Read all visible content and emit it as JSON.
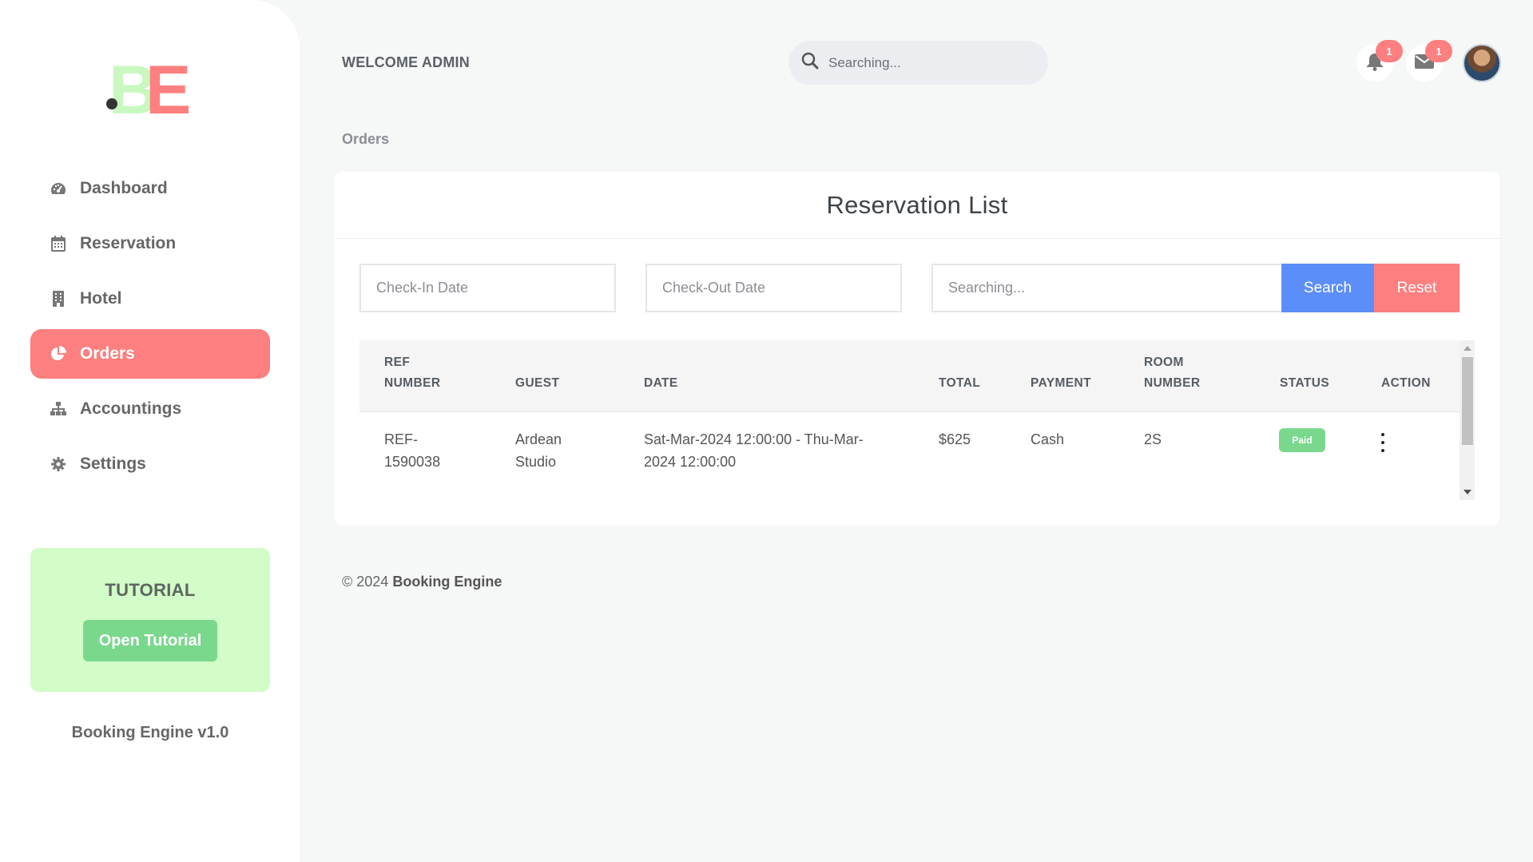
{
  "sidebar": {
    "logo_text": "BE",
    "items": [
      {
        "label": "Dashboard",
        "icon": "dashboard-icon"
      },
      {
        "label": "Reservation",
        "icon": "calendar-icon"
      },
      {
        "label": "Hotel",
        "icon": "building-icon"
      },
      {
        "label": "Orders",
        "icon": "pie-chart-icon",
        "active": true
      },
      {
        "label": "Accountings",
        "icon": "sitemap-icon"
      },
      {
        "label": "Settings",
        "icon": "gear-icon"
      }
    ],
    "tutorial": {
      "title": "TUTORIAL",
      "button": "Open Tutorial"
    },
    "version": "Booking Engine v1.0"
  },
  "header": {
    "welcome": "WELCOME ADMIN",
    "search_placeholder": "Searching...",
    "notifications_count": "1",
    "messages_count": "1"
  },
  "breadcrumb": "Orders",
  "card": {
    "title": "Reservation List",
    "filters": {
      "checkin_placeholder": "Check-In Date",
      "checkout_placeholder": "Check-Out Date",
      "search_placeholder": "Searching...",
      "search_button": "Search",
      "reset_button": "Reset"
    },
    "columns": [
      {
        "line1": "REF",
        "line2": "NUMBER"
      },
      {
        "line1": "",
        "line2": "GUEST"
      },
      {
        "line1": "",
        "line2": "DATE"
      },
      {
        "line1": "",
        "line2": "TOTAL"
      },
      {
        "line1": "",
        "line2": "PAYMENT"
      },
      {
        "line1": "ROOM",
        "line2": "NUMBER"
      },
      {
        "line1": "",
        "line2": "STATUS"
      },
      {
        "line1": "",
        "line2": "ACTION"
      }
    ],
    "rows": [
      {
        "ref_line1": "REF-",
        "ref_line2": "1590038",
        "guest_line1": "Ardean",
        "guest_line2": "Studio",
        "date_line1": "Sat-Mar-2024 12:00:00 - Thu-Mar-",
        "date_line2": "2024 12:00:00",
        "total": "$625",
        "payment": "Cash",
        "room": "2S",
        "status": "Paid"
      }
    ]
  },
  "footer": {
    "copyright": "© 2024",
    "brand": "Booking Engine"
  },
  "colors": {
    "accent": "#fd7f7f",
    "success": "#7ad88d",
    "primary": "#5b8ef9",
    "tutorial_bg": "#d2fcc8"
  }
}
